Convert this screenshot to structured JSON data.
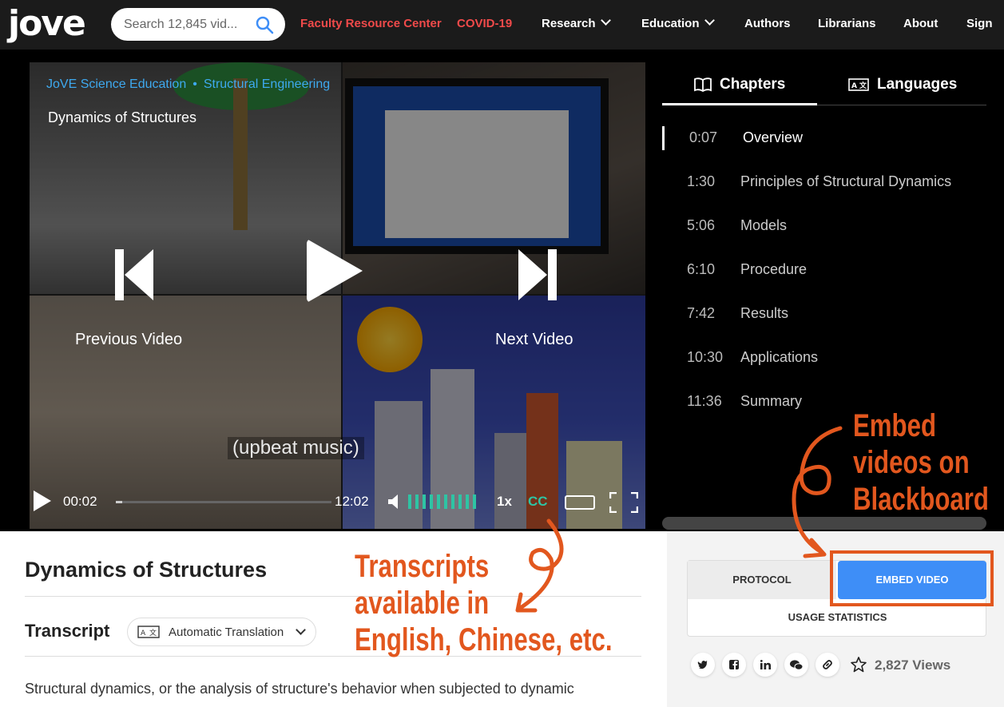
{
  "nav": {
    "logo": "jove",
    "search_placeholder": "Search 12,845 vid...",
    "links": [
      {
        "label": "Faculty Resource Center",
        "color": "#f04a4a"
      },
      {
        "label": "COVID-19",
        "color": "#f04a4a"
      },
      {
        "label": "Research",
        "dropdown": true
      },
      {
        "label": "Education",
        "dropdown": true
      },
      {
        "label": "Authors"
      },
      {
        "label": "Librarians"
      },
      {
        "label": "About"
      },
      {
        "label": "Sign"
      }
    ]
  },
  "video": {
    "breadcrumb": [
      "JoVE Science Education",
      "Structural Engineering"
    ],
    "title": "Dynamics of Structures",
    "prev_label": "Previous Video",
    "next_label": "Next Video",
    "current_time": "00:02",
    "duration": "12:02",
    "progress": 0.003,
    "speed": "1x",
    "cc": "CC",
    "caption": "(upbeat music)",
    "accent": "#2ec4a4"
  },
  "chapters": {
    "tabs": [
      {
        "label": "Chapters",
        "icon": "book-icon",
        "active": true
      },
      {
        "label": "Languages",
        "icon": "translate-icon",
        "active": false
      }
    ],
    "items": [
      {
        "time": "0:07",
        "label": "Overview",
        "active": true
      },
      {
        "time": "1:30",
        "label": "Principles of Structural Dynamics"
      },
      {
        "time": "5:06",
        "label": "Models"
      },
      {
        "time": "6:10",
        "label": "Procedure"
      },
      {
        "time": "7:42",
        "label": "Results"
      },
      {
        "time": "10:30",
        "label": "Applications"
      },
      {
        "time": "11:36",
        "label": "Summary"
      }
    ]
  },
  "article": {
    "title": "Dynamics of Structures",
    "transcript_heading": "Transcript",
    "translation_label": "Automatic Translation",
    "transcript_text": "Structural dynamics, or the analysis of structure's behavior when subjected to dynamic"
  },
  "side": {
    "protocol_label": "PROTOCOL",
    "embed_label": "EMBED VIDEO",
    "usage_label": "USAGE STATISTICS",
    "share": [
      "twitter-icon",
      "facebook-icon",
      "linkedin-icon",
      "wechat-icon",
      "link-icon",
      "star-icon"
    ],
    "views": "2,827 Views",
    "embed_color": "#3e8ef7"
  },
  "annotations": {
    "embed_lines": [
      "Embed",
      "videos on",
      "Blackboard"
    ],
    "transcript_lines": [
      "Transcripts",
      "available in",
      "English, Chinese, etc."
    ],
    "color": "#e2571e"
  }
}
